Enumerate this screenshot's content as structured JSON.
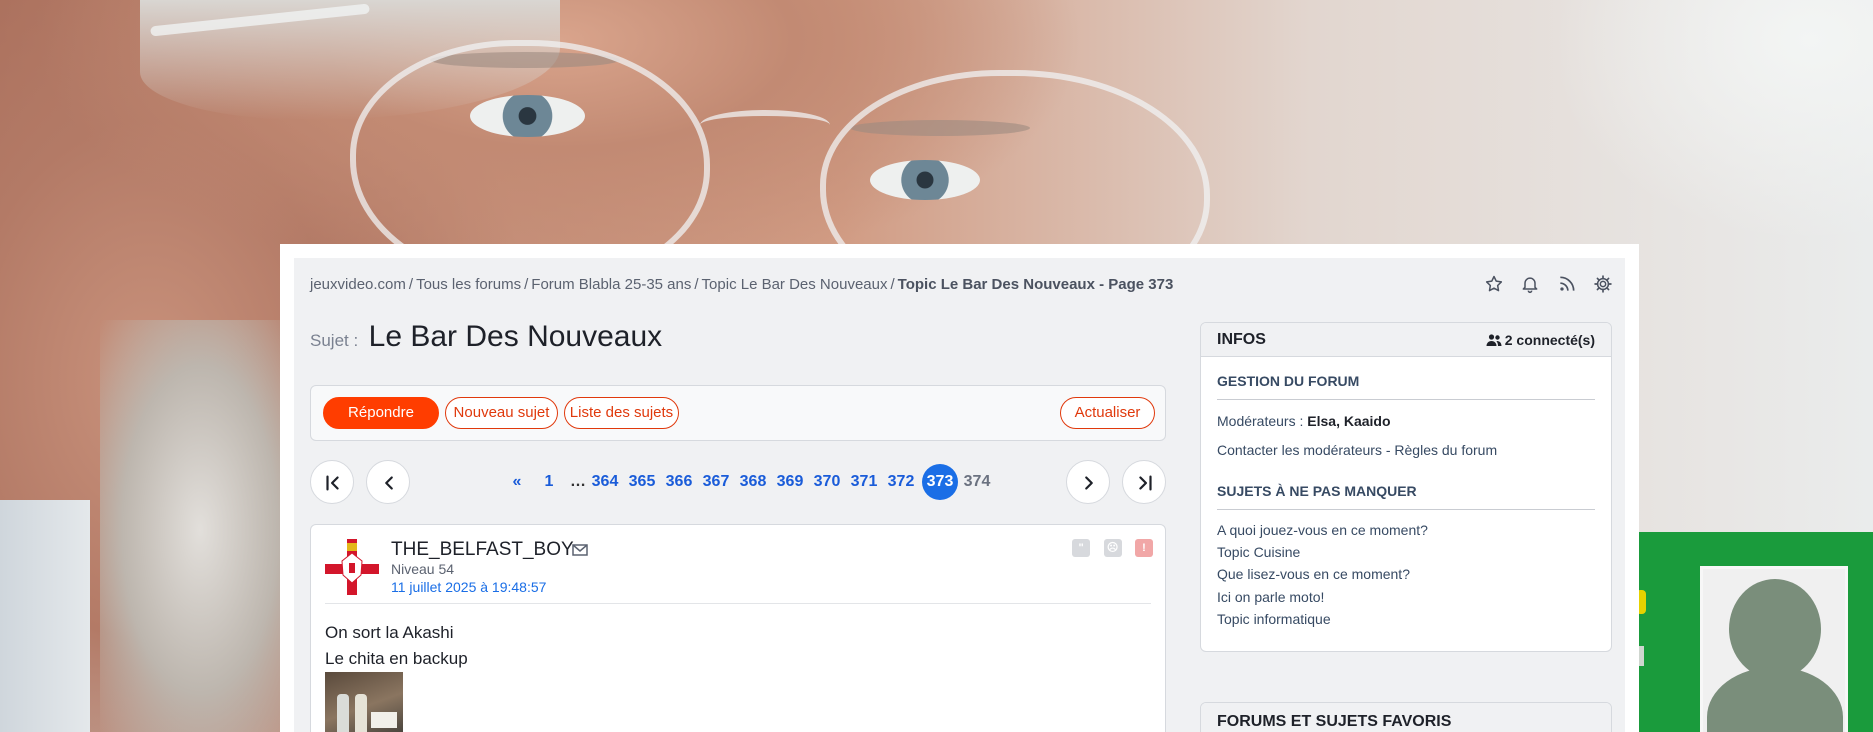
{
  "breadcrumb": {
    "items": [
      "jeuxvideo.com",
      "Tous les forums",
      "Forum Blabla 25-35 ans",
      "Topic Le Bar Des Nouveaux"
    ],
    "current": "Topic Le Bar Des Nouveaux - Page 373",
    "separator": "/"
  },
  "header_icons": [
    "star-icon",
    "bell-icon",
    "rss-icon",
    "gear-icon"
  ],
  "topic": {
    "label": "Sujet :",
    "title": "Le Bar Des Nouveaux"
  },
  "actions": {
    "reply": "Répondre",
    "new_topic": "Nouveau sujet",
    "topic_list": "Liste des sujets",
    "refresh": "Actualiser"
  },
  "pagination": {
    "first_label": "«",
    "pages": [
      "1",
      "…",
      "364",
      "365",
      "366",
      "367",
      "368",
      "369",
      "370",
      "371",
      "372",
      "373",
      "374"
    ],
    "current": "373"
  },
  "post": {
    "author": "THE_BELFAST_BOY",
    "level": "Niveau 54",
    "date": "11 juillet 2025 à 19:48:57",
    "lines": [
      "On sort la Akashi",
      "Le chita en backup"
    ],
    "tools": [
      "quote-icon",
      "block-icon",
      "report-icon"
    ]
  },
  "infos": {
    "title": "INFOS",
    "connected": "2 connecté(s)",
    "gestion_title": "GESTION DU FORUM",
    "moderators_label": "Modérateurs :",
    "moderators": "Elsa, Kaaido",
    "contact": "Contacter les modérateurs - Règles du forum",
    "must_see_title": "SUJETS À NE PAS MANQUER",
    "must_see": [
      "A quoi jouez-vous en ce moment?",
      "Topic Cuisine",
      "Que lisez-vous en ce moment?",
      "Ici on parle moto!",
      "Topic informatique"
    ]
  },
  "favorites": {
    "title": "FORUMS ET SUJETS FAVORIS"
  },
  "colors": {
    "accent": "#ff3d00",
    "link": "#1a6ee6",
    "current_page": "#1a6ee6"
  }
}
